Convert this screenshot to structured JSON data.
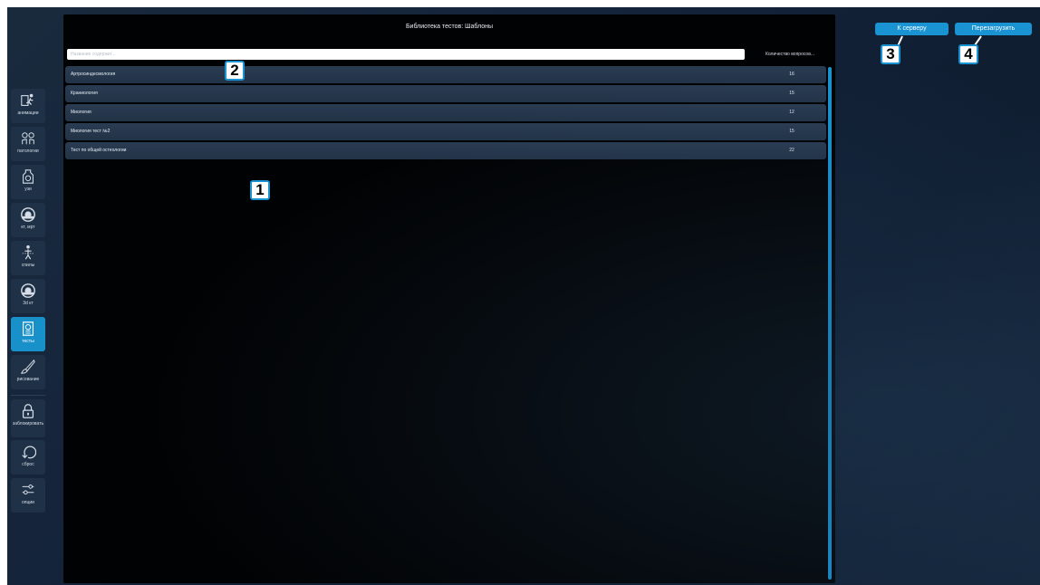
{
  "panel": {
    "title": "Библиотека тестов: Шаблоны",
    "search_placeholder": "Название содержит...",
    "count_header": "Количество вопросов...",
    "rows": [
      {
        "name": "Артросиндесмология",
        "count": "16"
      },
      {
        "name": "Краниология",
        "count": "15"
      },
      {
        "name": "Миология",
        "count": "12"
      },
      {
        "name": "Миология тест №2",
        "count": "15"
      },
      {
        "name": "Тест по общей остеологии",
        "count": "22"
      }
    ]
  },
  "buttons": {
    "server": "К серверу",
    "reload": "Перезагрузить"
  },
  "sidebar": {
    "items": [
      {
        "label": "анимации",
        "icon": "running-person-icon"
      },
      {
        "label": "патологии",
        "icon": "pathology-icon"
      },
      {
        "label": "узи",
        "icon": "ultrasound-icon"
      },
      {
        "label": "кт, мрт",
        "icon": "ct-scanner-icon"
      },
      {
        "label": "спилы",
        "icon": "body-slice-icon"
      },
      {
        "label": "3d кт",
        "icon": "ct-scanner-icon"
      },
      {
        "label": "тесты",
        "icon": "test-document-icon"
      },
      {
        "label": "рисование",
        "icon": "brush-icon"
      },
      {
        "label": "заблокировать",
        "icon": "lock-icon"
      },
      {
        "label": "сброс",
        "icon": "reset-icon"
      },
      {
        "label": "опции",
        "icon": "sliders-icon"
      }
    ]
  },
  "callouts": [
    "1",
    "2",
    "3",
    "4"
  ],
  "colors": {
    "accent": "#1a93d2",
    "background": "#14233a",
    "panel": "#010203",
    "row": "#263a50"
  }
}
